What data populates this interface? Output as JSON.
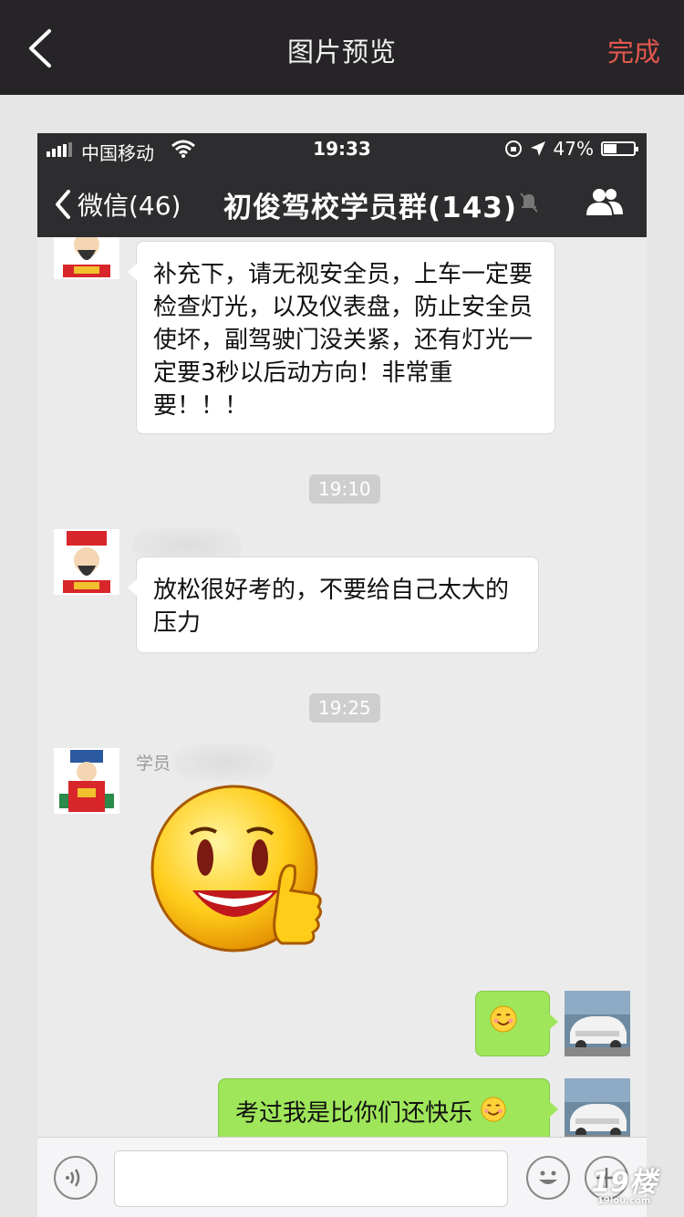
{
  "preview": {
    "title": "图片预览",
    "done_label": "完成"
  },
  "status": {
    "carrier": "中国移动",
    "time": "19:33",
    "battery_percent_text": "47%",
    "battery_level": 0.47
  },
  "chat": {
    "back_label": "微信(46)",
    "title": "初俊驾校学员群(143)"
  },
  "messages": [
    {
      "side": "left",
      "text": "补充下，请无视安全员，上车一定要检查灯光，以及仪表盘，防止安全员使坏，副驾驶门没关紧，还有灯光一定要3秒以后动方向！非常重要！！！"
    },
    {
      "type": "time",
      "text": "19:10"
    },
    {
      "side": "left",
      "text": "放松很好考的，不要给自己太大的压力"
    },
    {
      "type": "time",
      "text": "19:25"
    },
    {
      "side": "left",
      "sender": "学员",
      "type": "sticker"
    },
    {
      "side": "right",
      "text": ""
    },
    {
      "side": "right",
      "text": "考过我是比你们还快乐"
    }
  ],
  "watermark": {
    "label": "19楼",
    "sub": "19lou.com"
  }
}
